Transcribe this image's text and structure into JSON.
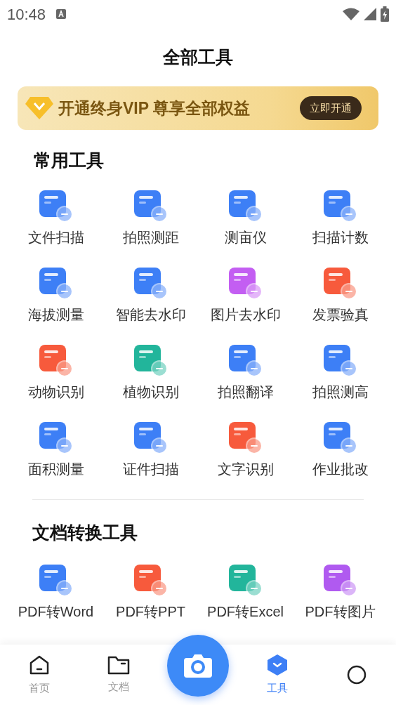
{
  "status_bar": {
    "time": "10:48"
  },
  "title": "全部工具",
  "vip_banner": {
    "text": "开通终身VIP 尊享全部权益",
    "button": "立即开通"
  },
  "sections": [
    {
      "title": "常用工具",
      "tools": [
        {
          "label": "文件扫描",
          "color": "#3d7ff6"
        },
        {
          "label": "拍照测距",
          "color": "#3d7ff6"
        },
        {
          "label": "测亩仪",
          "color": "#3d7ff6"
        },
        {
          "label": "扫描计数",
          "color": "#3d7ff6"
        },
        {
          "label": "海拔测量",
          "color": "#3d7ff6"
        },
        {
          "label": "智能去水印",
          "color": "#3d7ff6"
        },
        {
          "label": "图片去水印",
          "color": "#c35ef2"
        },
        {
          "label": "发票验真",
          "color": "#f75a3c"
        },
        {
          "label": "动物识别",
          "color": "#f75a3c"
        },
        {
          "label": "植物识别",
          "color": "#22b59b"
        },
        {
          "label": "拍照翻译",
          "color": "#3d7ff6"
        },
        {
          "label": "拍照测高",
          "color": "#3d7ff6"
        },
        {
          "label": "面积测量",
          "color": "#3d7ff6"
        },
        {
          "label": "证件扫描",
          "color": "#3d7ff6"
        },
        {
          "label": "文字识别",
          "color": "#f75a3c"
        },
        {
          "label": "作业批改",
          "color": "#3d7ff6"
        }
      ]
    },
    {
      "title": "文档转换工具",
      "tools": [
        {
          "label": "PDF转Word",
          "color": "#3d7ff6"
        },
        {
          "label": "PDF转PPT",
          "color": "#f75a3c"
        },
        {
          "label": "PDF转Excel",
          "color": "#22b59b"
        },
        {
          "label": "PDF转图片",
          "color": "#b05af0"
        }
      ]
    }
  ],
  "bottom_nav": [
    {
      "kind": "home",
      "label": "首页",
      "selected": false
    },
    {
      "kind": "docs",
      "label": "文档",
      "selected": false
    },
    {
      "kind": "camera",
      "selected": false
    },
    {
      "kind": "tools",
      "label": "工具",
      "selected": true
    },
    {
      "kind": "profile",
      "selected": false
    }
  ]
}
